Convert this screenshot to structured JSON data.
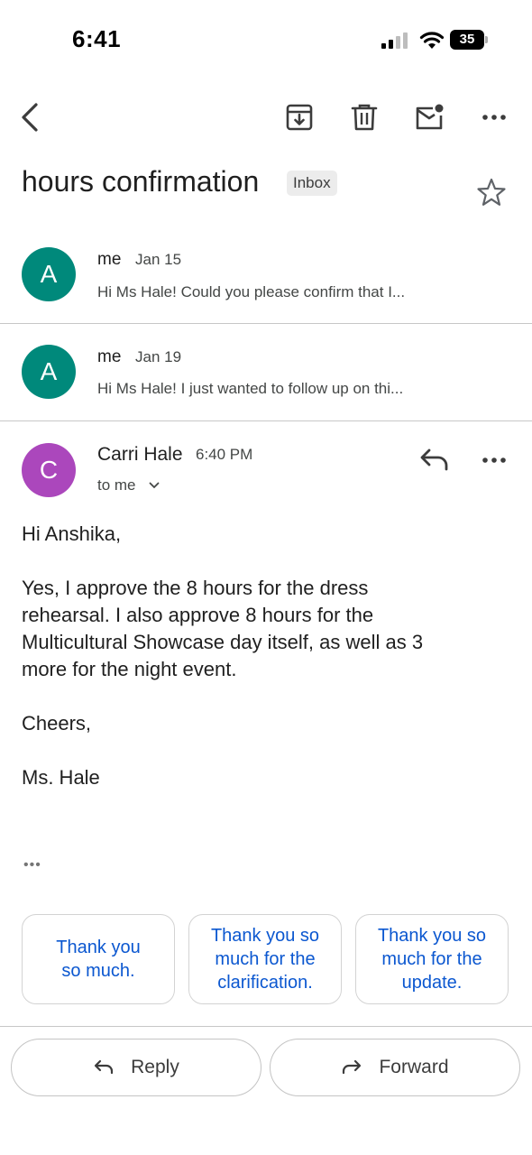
{
  "status_bar": {
    "time": "6:41",
    "battery": "35"
  },
  "toolbar": {
    "back_icon": "chevron-left-icon",
    "archive_icon": "archive-icon",
    "delete_icon": "trash-icon",
    "mark_unread_icon": "mail-unread-icon",
    "more_icon": "more-horizontal-icon"
  },
  "thread": {
    "subject": "hours confirmation",
    "label": "Inbox",
    "star_icon": "star-outline-icon"
  },
  "messages": [
    {
      "initial": "A",
      "sender": "me",
      "date": "Jan 15",
      "snippet": "Hi Ms Hale! Could you please confirm that I...",
      "avatar_color": "#00897b"
    },
    {
      "initial": "A",
      "sender": "me",
      "date": "Jan 19",
      "snippet": "Hi Ms Hale! I just wanted to follow up on thi...",
      "avatar_color": "#00897b"
    }
  ],
  "open_message": {
    "initial": "C",
    "avatar_color": "#ab47bc",
    "sender": "Carri Hale",
    "time": "6:40 PM",
    "recipient": "to me",
    "greeting": "Hi Anshika,",
    "paragraph_lines": [
      "Yes, I approve the 8 hours for the dress",
      "rehearsal.  I also approve 8 hours for the",
      "Multicultural Showcase day itself, as well as 3",
      "more for the night event."
    ],
    "closing": "Cheers,",
    "signature": "Ms. Hale",
    "quoted_toggle": "•••"
  },
  "smart_replies": [
    {
      "line1": "Thank you",
      "line2": "so much.",
      "line3": ""
    },
    {
      "line1": "Thank you so",
      "line2": "much for the",
      "line3": "clarification."
    },
    {
      "line1": "Thank you so",
      "line2": "much for the",
      "line3": "update."
    }
  ],
  "actions": {
    "reply": "Reply",
    "forward": "Forward"
  },
  "colors": {
    "accent": "#0b57d0",
    "teal_avatar": "#00897b",
    "purple_avatar": "#ab47bc"
  }
}
